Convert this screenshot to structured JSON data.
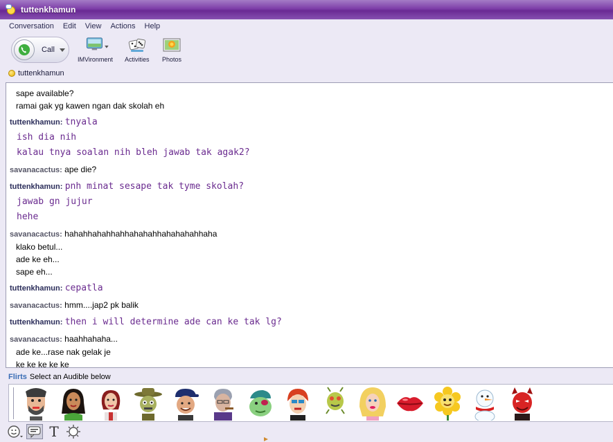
{
  "window": {
    "title": "tuttenkhamun"
  },
  "menu": [
    "Conversation",
    "Edit",
    "View",
    "Actions",
    "Help"
  ],
  "toolbar": {
    "call_label": "Call",
    "imvironment_label": "IMVironment",
    "activities_label": "Activities",
    "photos_label": "Photos"
  },
  "contact": {
    "name": "tuttenkhamun",
    "status_color": "#f2c21a"
  },
  "colors": {
    "titlebar": "#7d3ea8",
    "self_text": "#6a2b8f",
    "self_name": "#2b2d5a",
    "other_name": "#555566",
    "flirts": "#3a6db5"
  },
  "messages": [
    {
      "sender": "",
      "kind": "other",
      "lines": [
        "sape available?",
        "ramai gak yg kawen ngan dak skolah eh"
      ]
    },
    {
      "sender": "tuttenkhamun:",
      "kind": "self",
      "first": "tnyala",
      "lines": [
        "ish dia nih",
        "kalau tnya soalan nih bleh jawab tak agak2?"
      ]
    },
    {
      "sender": "savanacactus:",
      "kind": "other",
      "first": "ape die?",
      "lines": []
    },
    {
      "sender": "tuttenkhamun:",
      "kind": "self",
      "first": "pnh minat sesape tak tyme skolah?",
      "lines": [
        "jawab gn jujur",
        "hehe"
      ]
    },
    {
      "sender": "savanacactus:",
      "kind": "other",
      "first": "hahahhahahhahhahahahhahahahahhaha",
      "lines": [
        "klako betul...",
        "ade ke eh...",
        "sape eh..."
      ]
    },
    {
      "sender": "tuttenkhamun:",
      "kind": "self",
      "first": "cepatla",
      "lines": []
    },
    {
      "sender": "savanacactus:",
      "kind": "other",
      "first": "hmm....jap2 pk balik",
      "lines": []
    },
    {
      "sender": "tuttenkhamun:",
      "kind": "self",
      "first": "then i will determine ade can ke tak lg?",
      "lines": []
    },
    {
      "sender": "savanacactus:",
      "kind": "other",
      "first": "haahhahaha...",
      "lines": [
        "ade ke...rase nak gelak je",
        "ke ke ke ke ke"
      ]
    }
  ],
  "flirts": {
    "label": "Flirts",
    "hint": "Select an Audible below"
  },
  "audibles": [
    "man-with-beard",
    "woman-green-dress",
    "woman-red-hair",
    "cowboy-zombie",
    "man-blue-cap",
    "old-man-cigar",
    "green-pirate-lady",
    "redhead-pop-face",
    "green-bug",
    "blonde-woman",
    "red-lips",
    "sunflower",
    "snowman",
    "red-devil"
  ],
  "bottom_tools": [
    "emoticon-icon",
    "audible-icon",
    "text-format-icon",
    "wink-icon"
  ]
}
